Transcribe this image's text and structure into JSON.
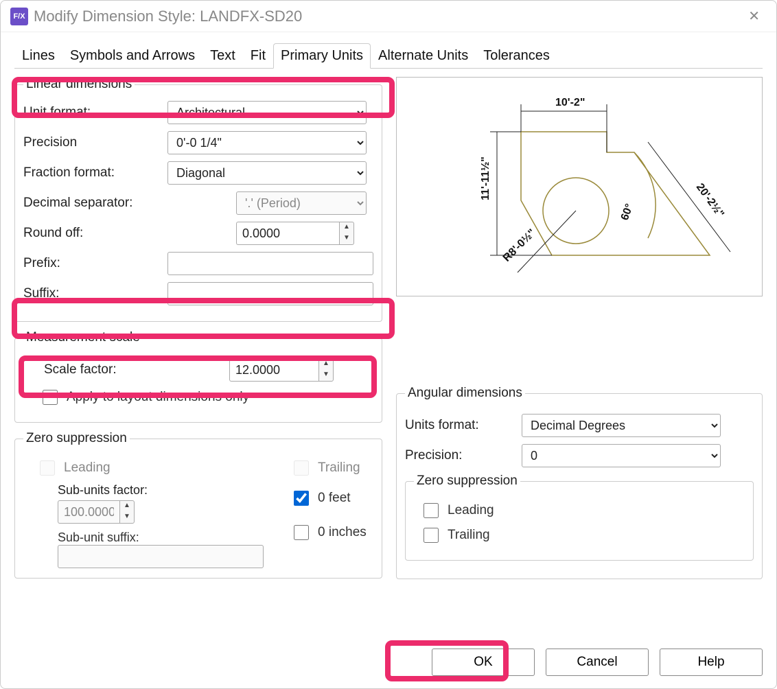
{
  "title": "Modify Dimension Style: LANDFX-SD20",
  "tabs": [
    "Lines",
    "Symbols and Arrows",
    "Text",
    "Fit",
    "Primary Units",
    "Alternate Units",
    "Tolerances"
  ],
  "active_tab": "Primary Units",
  "linear": {
    "legend": "Linear dimensions",
    "unit_format_label": "Unit format:",
    "unit_format": "Architectural",
    "precision_label": "Precision",
    "precision": "0'-0 1/4\"",
    "fraction_format_label": "Fraction format:",
    "fraction_format": "Diagonal",
    "decimal_sep_label": "Decimal separator:",
    "decimal_sep": "'.' (Period)",
    "round_off_label": "Round off:",
    "round_off": "0.0000",
    "prefix_label": "Prefix:",
    "prefix": "",
    "suffix_label": "Suffix:",
    "suffix": ""
  },
  "measurement": {
    "legend": "Measurement scale",
    "scale_factor_label": "Scale factor:",
    "scale_factor": "12.0000",
    "apply_label": "Apply to layout dimensions only",
    "apply": false
  },
  "zero": {
    "legend": "Zero suppression",
    "leading_label": "Leading",
    "leading": false,
    "subunits_factor_label": "Sub-units factor:",
    "subunits_factor": "100.0000",
    "subunit_suffix_label": "Sub-unit suffix:",
    "subunit_suffix": "",
    "trailing_label": "Trailing",
    "trailing": false,
    "feet_label": "0 feet",
    "feet": true,
    "inches_label": "0 inches",
    "inches": false
  },
  "angular": {
    "legend": "Angular dimensions",
    "units_format_label": "Units format:",
    "units_format": "Decimal Degrees",
    "precision_label": "Precision:",
    "precision": "0",
    "zero_legend": "Zero suppression",
    "leading_label": "Leading",
    "leading": false,
    "trailing_label": "Trailing",
    "trailing": false
  },
  "preview": {
    "top": "10'-2\"",
    "left": "11'-11½\"",
    "diag": "20'-2½\"",
    "angle": "60°",
    "radius": "R8'-0½\""
  },
  "buttons": {
    "ok": "OK",
    "cancel": "Cancel",
    "help": "Help"
  }
}
